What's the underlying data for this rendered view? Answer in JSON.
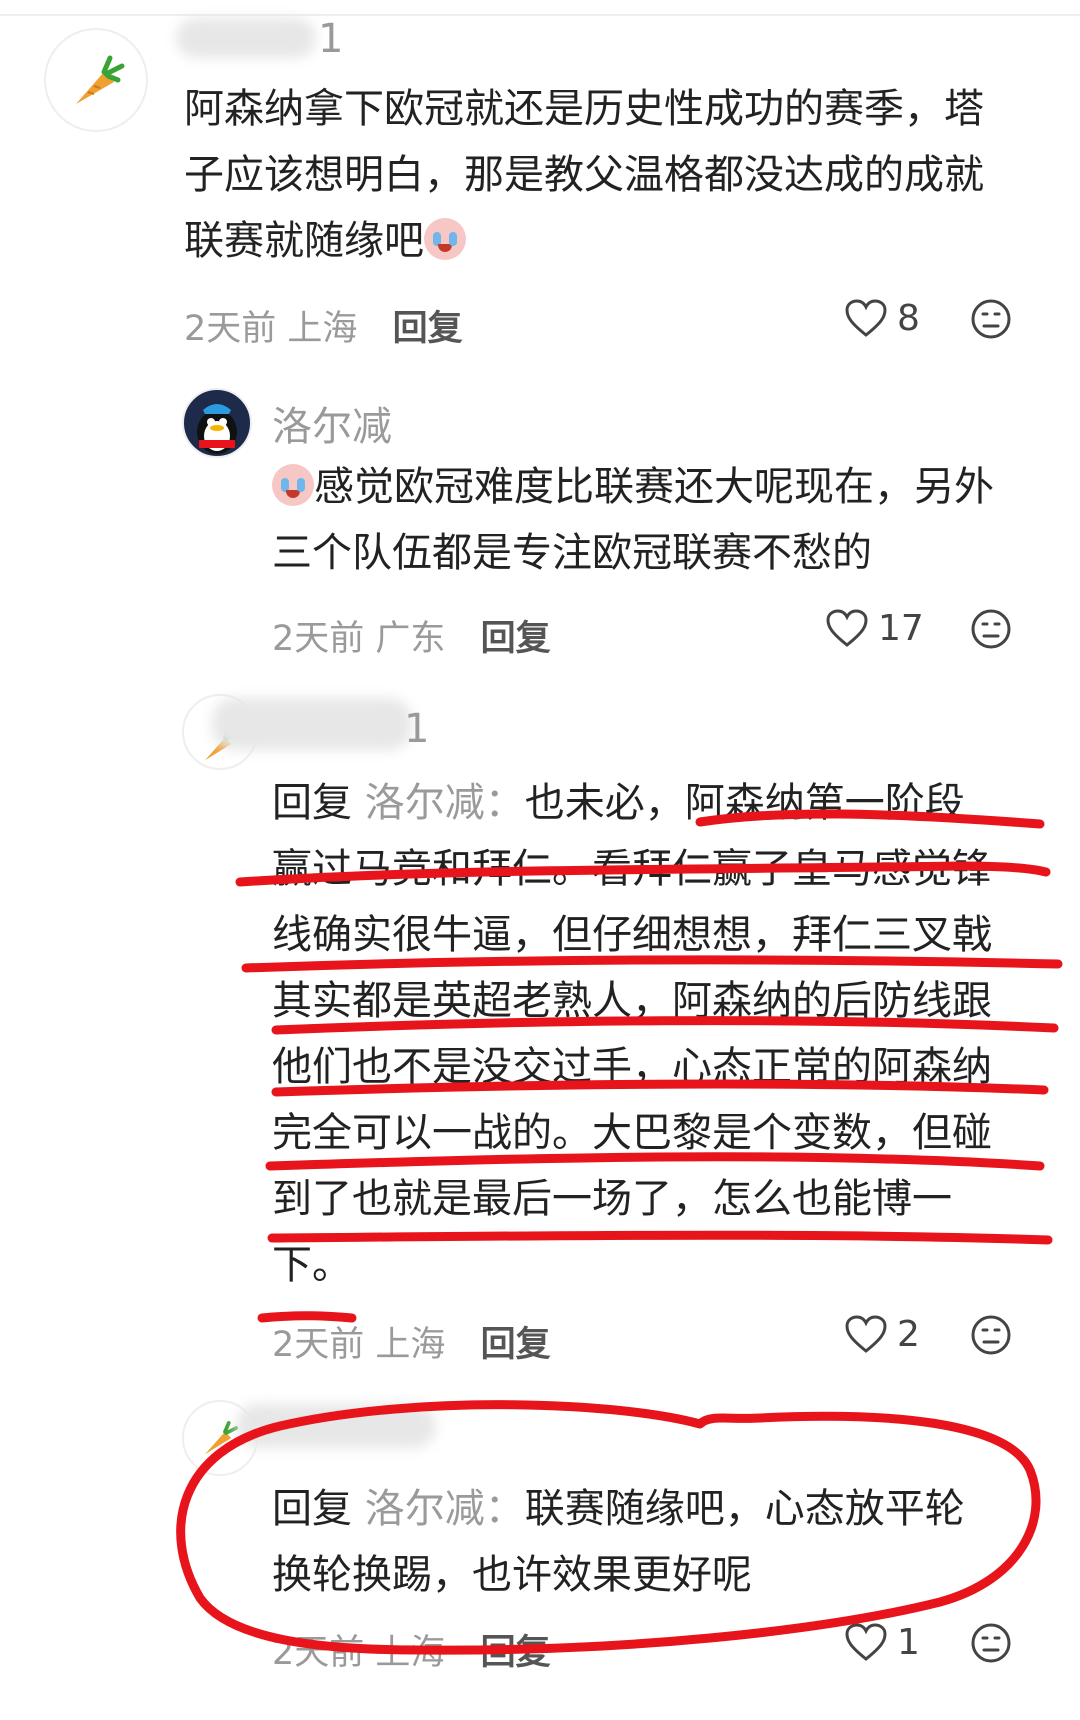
{
  "comments": [
    {
      "id": "c1",
      "username_visible": "1",
      "avatar_icon": "carrot-icon",
      "lines": [
        "阿森纳拿下欧冠就还是历史性成功的赛季，塔",
        "子应该想明白，那是教父温格都没达成的成就",
        "联赛就随缘吧"
      ],
      "time": "2天前",
      "location": "上海",
      "reply_label": "回复",
      "likes": "8"
    },
    {
      "id": "c2",
      "username": "洛尔减",
      "avatar_icon": "penguin-icon",
      "lines": [
        "感觉欧冠难度比联赛还大呢现在，另外",
        "三个队伍都是专注欧冠联赛不愁的"
      ],
      "time": "2天前",
      "location": "广东",
      "reply_label": "回复",
      "likes": "17"
    },
    {
      "id": "c3",
      "username_visible": "1",
      "avatar_icon": "carrot-icon",
      "reply_prefix": "回复",
      "reply_to": "洛尔减：",
      "lines": [
        "也未必，阿森纳第一阶段",
        "赢过马竞和拜仁。看拜仁赢了皇马感觉锋",
        "线确实很牛逼，但仔细想想，拜仁三叉戟",
        "其实都是英超老熟人，阿森纳的后防线跟",
        "他们也不是没交过手，心态正常的阿森纳",
        "完全可以一战的。大巴黎是个变数，但碰",
        "到了也就是最后一场了，怎么也能博一",
        "下。"
      ],
      "time": "2天前",
      "location": "上海",
      "reply_label": "回复",
      "likes": "2"
    },
    {
      "id": "c4",
      "avatar_icon": "carrot-icon",
      "reply_prefix": "回复",
      "reply_to": "洛尔减：",
      "lines": [
        "联赛随缘吧，心态放平轮",
        "换轮换踢，也许效果更好呢"
      ],
      "time": "2天前",
      "location": "上海",
      "reply_label": "回复",
      "likes": "1"
    }
  ],
  "icons": {
    "like": "heart-outline-icon",
    "reaction": "neutral-face-icon",
    "inline_emoji": "crying-face-emoji-icon"
  },
  "colors": {
    "annotation": "#e8141b",
    "muted_text": "#9a9a9a",
    "body_text": "#222222"
  }
}
